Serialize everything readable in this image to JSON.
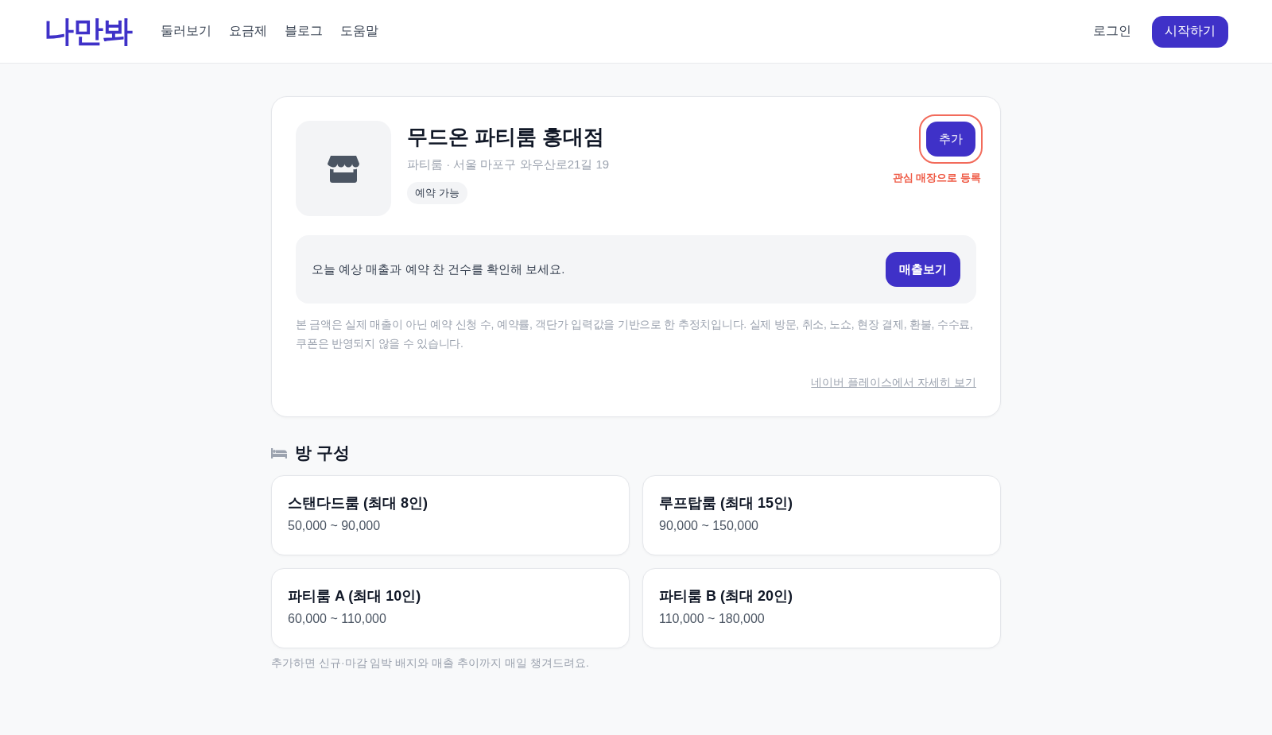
{
  "header": {
    "logo": "나만봐",
    "nav": [
      "둘러보기",
      "요금제",
      "블로그",
      "도움말"
    ],
    "login": "로그인",
    "start_button": "시작하기"
  },
  "store": {
    "name": "무드온 파티룸 홍대점",
    "address": "파티룸 · 서울 마포구 와우산로21길 19",
    "badge": "예약 가능",
    "add_button": {
      "label": "추가",
      "highlighted": true
    },
    "add_hint": "관심 매장으로 등록"
  },
  "sales_banner": {
    "text": "오늘 예상 매출과 예약 찬 건수를 확인해 보세요.",
    "button": "매출보기"
  },
  "disclaimer": "본 금액은 실제 매출이 아닌 예약 신청 수, 예약률, 객단가 입력값을 기반으로 한 추정치입니다. 실제 방문, 취소, 노쇼, 현장 결제, 환불, 수수료, 쿠폰은 반영되지 않을 수 있습니다.",
  "detail_link": "네이버 플레이스에서 자세히 보기",
  "rooms": {
    "title": "방 구성",
    "items": [
      {
        "name": "스탠다드룸 (최대 8인)",
        "price": "50,000 ~ 90,000"
      },
      {
        "name": "루프탑룸 (최대 15인)",
        "price": "90,000 ~ 150,000"
      },
      {
        "name": "파티룸 A (최대 10인)",
        "price": "60,000 ~ 110,000"
      },
      {
        "name": "파티룸 B (최대 20인)",
        "price": "110,000 ~ 180,000"
      }
    ],
    "footnote": "추가하면 신규·마감 임박 배지와 매출 추이까지 매일 챙겨드려요."
  }
}
